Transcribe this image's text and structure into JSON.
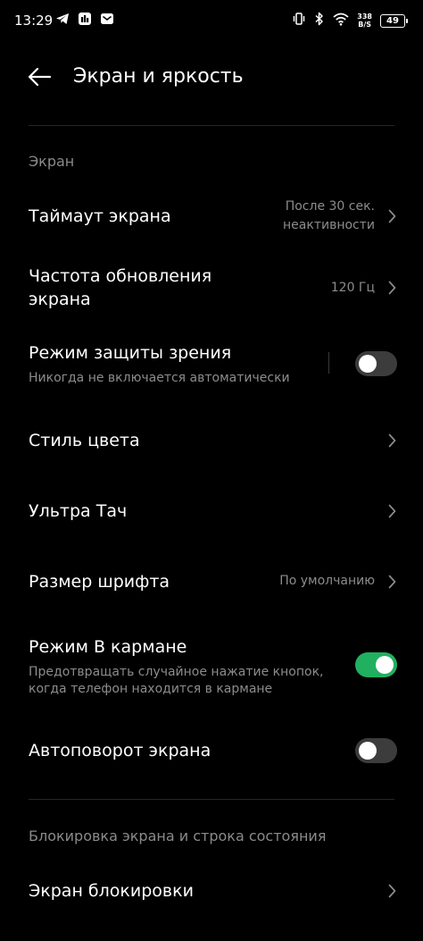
{
  "status_bar": {
    "time": "13:29",
    "net_speed_value": "338",
    "net_speed_unit": "B/S",
    "battery": "49",
    "icons_left": [
      "telegram-icon",
      "app-icon",
      "mail-icon"
    ],
    "icons_right": [
      "vibrate-icon",
      "bluetooth-icon",
      "wifi-icon"
    ]
  },
  "header": {
    "title": "Экран и яркость"
  },
  "sections": {
    "screen": "Экран",
    "lock": "Блокировка экрана и строка состояния"
  },
  "items": {
    "timeout": {
      "title": "Таймаут экрана",
      "value_line1": "После 30 сек.",
      "value_line2": "неактивности"
    },
    "refresh": {
      "title_line1": "Частота обновления",
      "title_line2": "экрана",
      "value": "120 Гц"
    },
    "eye": {
      "title": "Режим защиты зрения",
      "subtitle": "Никогда не включается автоматически",
      "enabled": false
    },
    "color_style": {
      "title": "Стиль цвета"
    },
    "ultra_touch": {
      "title": "Ультра Тач"
    },
    "font_size": {
      "title": "Размер шрифта",
      "value": "По умолчанию"
    },
    "pocket": {
      "title": "Режим В кармане",
      "subtitle_line1": "Предотвращать случайное нажатие кнопок,",
      "subtitle_line2": "когда телефон находится в кармане",
      "enabled": true
    },
    "autorotate": {
      "title": "Автоповорот экрана",
      "enabled": false
    },
    "lock_screen": {
      "title": "Экран блокировки"
    }
  },
  "colors": {
    "background": "#000000",
    "toggle_on": "#21b05f",
    "toggle_off": "#3c3c3c",
    "secondary_text": "#8c8c8c"
  }
}
